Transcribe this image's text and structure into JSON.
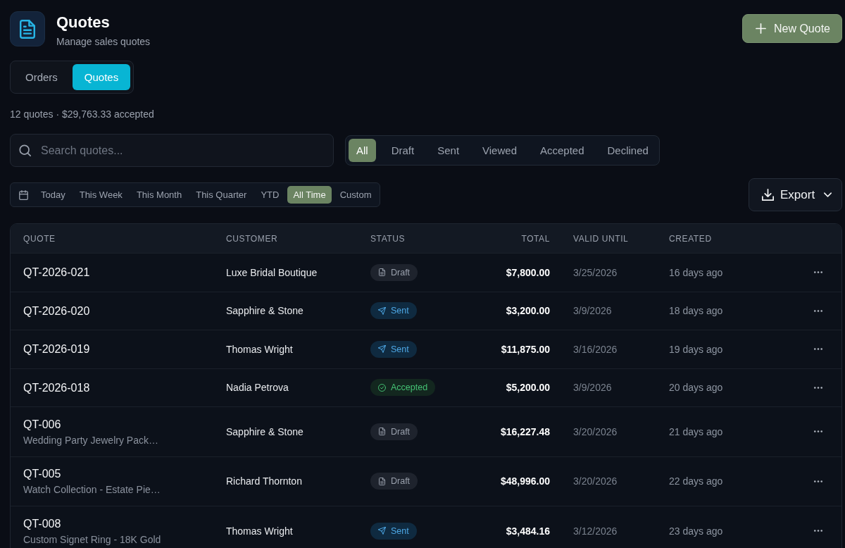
{
  "header": {
    "title": "Quotes",
    "subtitle": "Manage sales quotes"
  },
  "new_button": {
    "label": "New Quote"
  },
  "tabs": [
    {
      "label": "Orders",
      "selected": false
    },
    {
      "label": "Quotes",
      "selected": true
    }
  ],
  "summary": "12 quotes · $29,763.33 accepted",
  "search": {
    "placeholder": "Search quotes..."
  },
  "status_filters": [
    {
      "label": "All",
      "selected": true
    },
    {
      "label": "Draft",
      "selected": false
    },
    {
      "label": "Sent",
      "selected": false
    },
    {
      "label": "Viewed",
      "selected": false
    },
    {
      "label": "Accepted",
      "selected": false
    },
    {
      "label": "Declined",
      "selected": false
    }
  ],
  "date_ranges": [
    {
      "label": "Today",
      "selected": false
    },
    {
      "label": "This Week",
      "selected": false
    },
    {
      "label": "This Month",
      "selected": false
    },
    {
      "label": "This Quarter",
      "selected": false
    },
    {
      "label": "YTD",
      "selected": false
    },
    {
      "label": "All Time",
      "selected": true
    },
    {
      "label": "Custom",
      "selected": false
    }
  ],
  "export_button": {
    "label": "Export"
  },
  "table": {
    "columns": [
      "QUOTE",
      "CUSTOMER",
      "STATUS",
      "TOTAL",
      "VALID UNTIL",
      "CREATED"
    ],
    "rows": [
      {
        "quote": "QT-2026-021",
        "customer": "Luxe Bridal Boutique",
        "status": {
          "label": "Draft",
          "kind": "draft"
        },
        "total": "$7,800.00",
        "valid_until": "3/25/2026",
        "created": "16 days ago"
      },
      {
        "quote": "QT-2026-020",
        "customer": "Sapphire & Stone",
        "status": {
          "label": "Sent",
          "kind": "sent"
        },
        "total": "$3,200.00",
        "valid_until": "3/9/2026",
        "created": "18 days ago"
      },
      {
        "quote": "QT-2026-019",
        "customer": "Thomas Wright",
        "status": {
          "label": "Sent",
          "kind": "sent"
        },
        "total": "$11,875.00",
        "valid_until": "3/16/2026",
        "created": "19 days ago"
      },
      {
        "quote": "QT-2026-018",
        "customer": "Nadia Petrova",
        "status": {
          "label": "Accepted",
          "kind": "accepted"
        },
        "total": "$5,200.00",
        "valid_until": "3/9/2026",
        "created": "20 days ago"
      },
      {
        "quote": "QT-006",
        "description": "Wedding Party Jewelry Pack…",
        "customer": "Sapphire & Stone",
        "status": {
          "label": "Draft",
          "kind": "draft"
        },
        "total": "$16,227.48",
        "valid_until": "3/20/2026",
        "created": "21 days ago"
      },
      {
        "quote": "QT-005",
        "description": "Watch Collection - Estate Pie…",
        "customer": "Richard Thornton",
        "status": {
          "label": "Draft",
          "kind": "draft"
        },
        "total": "$48,996.00",
        "valid_until": "3/20/2026",
        "created": "22 days ago"
      },
      {
        "quote": "QT-008",
        "description": "Custom Signet Ring - 18K Gold",
        "customer": "Thomas Wright",
        "status": {
          "label": "Sent",
          "kind": "sent"
        },
        "total": "$3,484.16",
        "valid_until": "3/12/2026",
        "created": "23 days ago"
      }
    ]
  }
}
